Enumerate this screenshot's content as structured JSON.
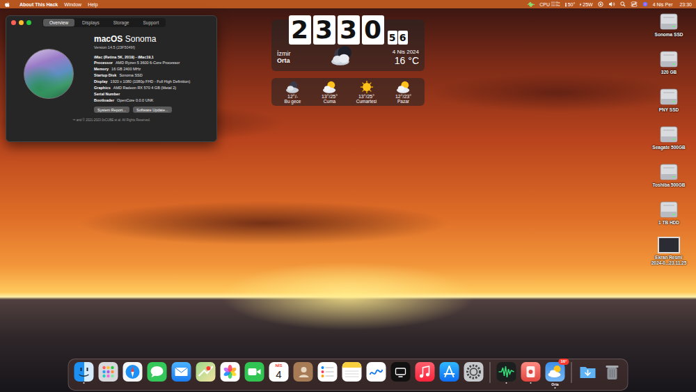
{
  "menu_bar": {
    "app_name": "About This Hack",
    "items": [
      "Window",
      "Help"
    ],
    "cpu": {
      "label": "CPU",
      "freq_top": "4.0 Ghz",
      "freq_bottom": "3.6 Ghz"
    },
    "temperature": "50°",
    "power": "25W",
    "date": "4 Nis Per",
    "time": "23:30"
  },
  "about_window": {
    "tabs": [
      {
        "label": "Overview",
        "selected": true
      },
      {
        "label": "Displays",
        "selected": false
      },
      {
        "label": "Storage",
        "selected": false
      },
      {
        "label": "Support",
        "selected": false
      }
    ],
    "os_name": "macOS",
    "os_release": "Sonoma",
    "version": "Version 14.5 (23F5049f)",
    "model": "iMac (Retina 5K, 2019) - iMac19,1",
    "specs": [
      {
        "label": "Processor",
        "value": "AMD Ryzen 5 3600 6-Core Processor"
      },
      {
        "label": "Memory",
        "value": "16 GB 2400 MHz"
      },
      {
        "label": "Startup Disk",
        "value": "Sonoma SSD"
      },
      {
        "label": "Display",
        "value": "1920 x 1080 (1080p FHD - Full High Definition)"
      },
      {
        "label": "Graphics",
        "value": "AMD Radeon RX 570 4 GB (Metal 2)"
      },
      {
        "label": "Serial Number"
      },
      {
        "label": "Bootloader",
        "value": "OpenCore 0.0.0 UNK"
      }
    ],
    "buttons": [
      "System Report...",
      "Software Update..."
    ],
    "footer": "™ and © 2021-2023 0xCUBE et al. All Rights Reserved."
  },
  "clock_widget": {
    "digits": [
      "2",
      "3",
      "3",
      "0"
    ],
    "seconds": [
      "5",
      "6"
    ],
    "city": "İzmir",
    "condition": "Orta",
    "date": "4 Nis 2024",
    "temperature": "16 °C",
    "icon": "moon-cloud"
  },
  "forecast": [
    {
      "kind": "moon-cloud",
      "temps": "12°/-",
      "day": "Bu gece"
    },
    {
      "kind": "sun-cloud",
      "temps": "13°/25°",
      "day": "Cuma"
    },
    {
      "kind": "sun",
      "temps": "13°/25°",
      "day": "Cumartesi"
    },
    {
      "kind": "sun-cloud",
      "temps": "12°/23°",
      "day": "Pazar"
    }
  ],
  "desktop_icons": [
    {
      "kind": "disk",
      "lines": [
        "Sonoma SSD"
      ]
    },
    {
      "kind": "disk",
      "lines": [
        "320 GB"
      ]
    },
    {
      "kind": "disk",
      "lines": [
        "PNY SSD"
      ]
    },
    {
      "kind": "disk",
      "lines": [
        "Seagate 500GB"
      ]
    },
    {
      "kind": "disk",
      "lines": [
        "Toshiba 500GB"
      ]
    },
    {
      "kind": "disk",
      "lines": [
        "1 TB HDD"
      ]
    },
    {
      "kind": "screenshot",
      "lines": [
        "Ekran Resmi",
        "2024-0...23.11.25"
      ]
    }
  ],
  "dock": {
    "groups": [
      {
        "items": [
          {
            "kind": "finder",
            "running": true
          },
          {
            "kind": "launchpad",
            "running": false
          },
          {
            "kind": "safari",
            "running": false
          },
          {
            "kind": "messages",
            "running": false
          },
          {
            "kind": "mail",
            "running": false
          },
          {
            "kind": "maps",
            "running": false
          },
          {
            "kind": "photos",
            "running": false
          },
          {
            "kind": "facetime",
            "running": false
          },
          {
            "kind": "calendar",
            "running": false,
            "month": "NİS",
            "day": "4"
          },
          {
            "kind": "contacts",
            "running": false
          },
          {
            "kind": "reminders",
            "running": false
          },
          {
            "kind": "notes",
            "running": false
          },
          {
            "kind": "freeform",
            "running": false
          },
          {
            "kind": "tv",
            "running": false
          },
          {
            "kind": "music",
            "running": false
          },
          {
            "kind": "appstore",
            "running": false
          },
          {
            "kind": "settings",
            "running": false
          }
        ]
      },
      {
        "items": [
          {
            "kind": "activity",
            "running": true
          },
          {
            "kind": "redapp",
            "running": true
          },
          {
            "kind": "weather",
            "running": true,
            "badge": "16°",
            "label": "Orta"
          }
        ]
      },
      {
        "items": [
          {
            "kind": "downloads",
            "running": false
          },
          {
            "kind": "trash",
            "running": false
          }
        ]
      }
    ]
  }
}
